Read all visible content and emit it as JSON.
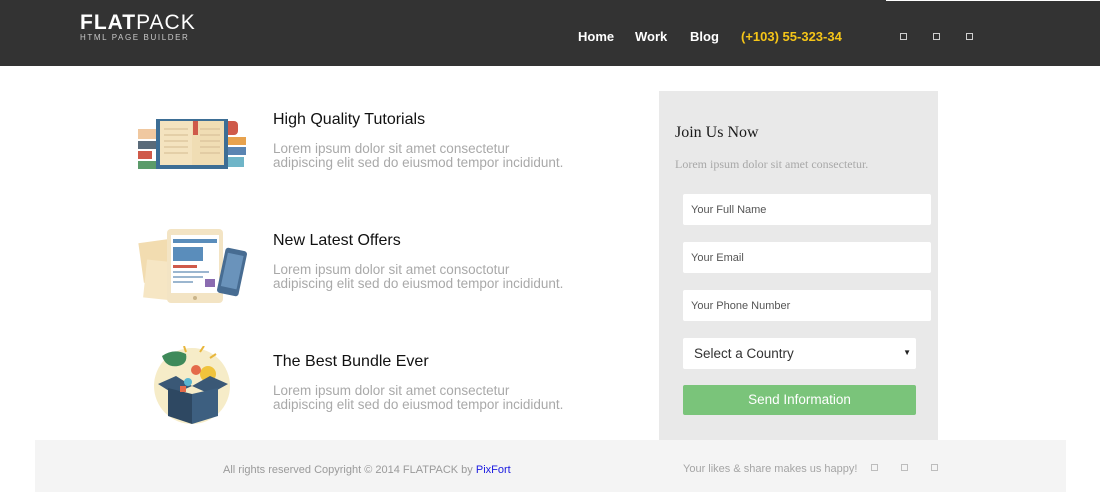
{
  "header": {
    "logo_text_bold": "FLAT",
    "logo_text_light": "PACK",
    "logo_subtitle": "HTML PAGE BUILDER",
    "nav": [
      {
        "label": "Home"
      },
      {
        "label": "Work"
      },
      {
        "label": "Blog"
      }
    ],
    "phone": "(+103) 55-323-34",
    "phone_color": "#f5c518",
    "bar_color": "#333333",
    "social_icons": [
      "social-icon-1",
      "social-icon-2",
      "social-icon-3"
    ]
  },
  "features": [
    {
      "icon": "books-icon",
      "title": "High Quality Tutorials",
      "text": "Lorem ipsum dolor sit amet consectetur adipiscing elit sed do eiusmod tempor incididunt."
    },
    {
      "icon": "tablet-icon",
      "title": "New Latest Offers",
      "text": "Lorem ipsum dolor sit amet consoctotur adipiscing elit sed do eiusmod tempor incididunt."
    },
    {
      "icon": "box-icon",
      "title": "The Best Bundle Ever",
      "text": "Lorem ipsum dolor sit amet consectetur adipiscing elit sed do eiusmod tempor incididunt."
    }
  ],
  "form": {
    "title": "Join Us Now",
    "subtitle": "Lorem ipsum dolor sit amet consectetur.",
    "fields": {
      "name_placeholder": "Your Full Name",
      "email_placeholder": "Your Email",
      "phone_placeholder": "Your Phone Number"
    },
    "country_select": "Select a Country",
    "submit_label": "Send Information",
    "submit_color": "#7ac47a",
    "panel_color": "#e9e9e9"
  },
  "footer": {
    "copyright": "All rights reserved Copyright © 2014 FLATPACK by",
    "brand_link": "PixFort",
    "likes_text": "Your likes & share makes us happy!",
    "social_icons": [
      "footer-social-icon-1",
      "footer-social-icon-2",
      "footer-social-icon-3"
    ]
  }
}
